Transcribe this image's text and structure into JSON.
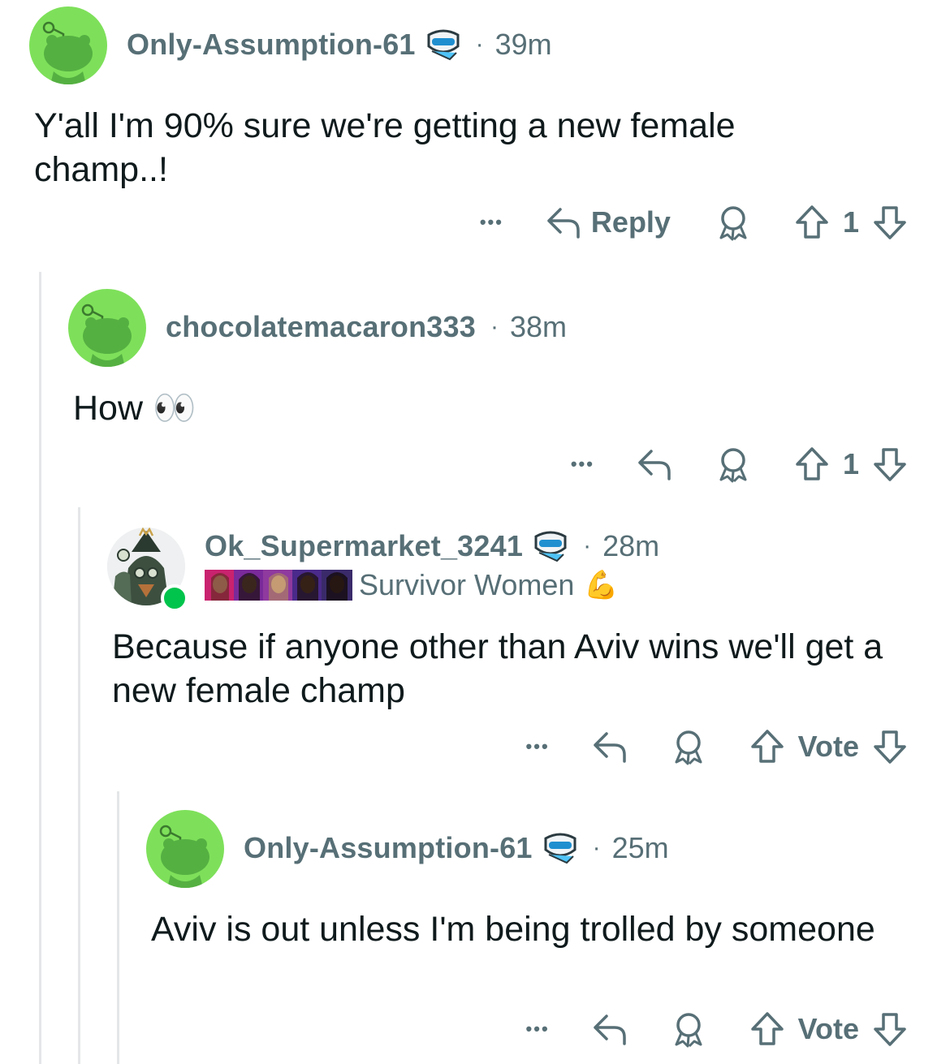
{
  "comments": [
    {
      "username": "Only-Assumption-61",
      "time": "39m",
      "body": "Y'all I'm 90% sure we're getting a new female champ..!",
      "reply_label": "Reply",
      "vote": "1"
    },
    {
      "username": "chocolatemacaron333",
      "time": "38m",
      "body": "How 👀",
      "vote": "1"
    },
    {
      "username": "Ok_Supermarket_3241",
      "time": "28m",
      "flair": "Survivor Women",
      "flair_emoji": "💪",
      "body": "Because if anyone other than Aviv wins we'll get a new female champ",
      "vote": "Vote"
    },
    {
      "username": "Only-Assumption-61",
      "time": "25m",
      "body": "Aviv is out unless I'm being trolled by someone",
      "vote": "Vote"
    }
  ],
  "separator": "·",
  "more_label": "•••",
  "colors": {
    "avatar_green": "#7ee05a",
    "muted": "#576f76",
    "thread_line": "#e4e6e8",
    "online": "#01c44c"
  },
  "icons": [
    "snoo-avatar",
    "sunglasses-badge-icon",
    "reply-icon",
    "award-icon",
    "upvote-icon",
    "downvote-icon",
    "more-icon"
  ]
}
